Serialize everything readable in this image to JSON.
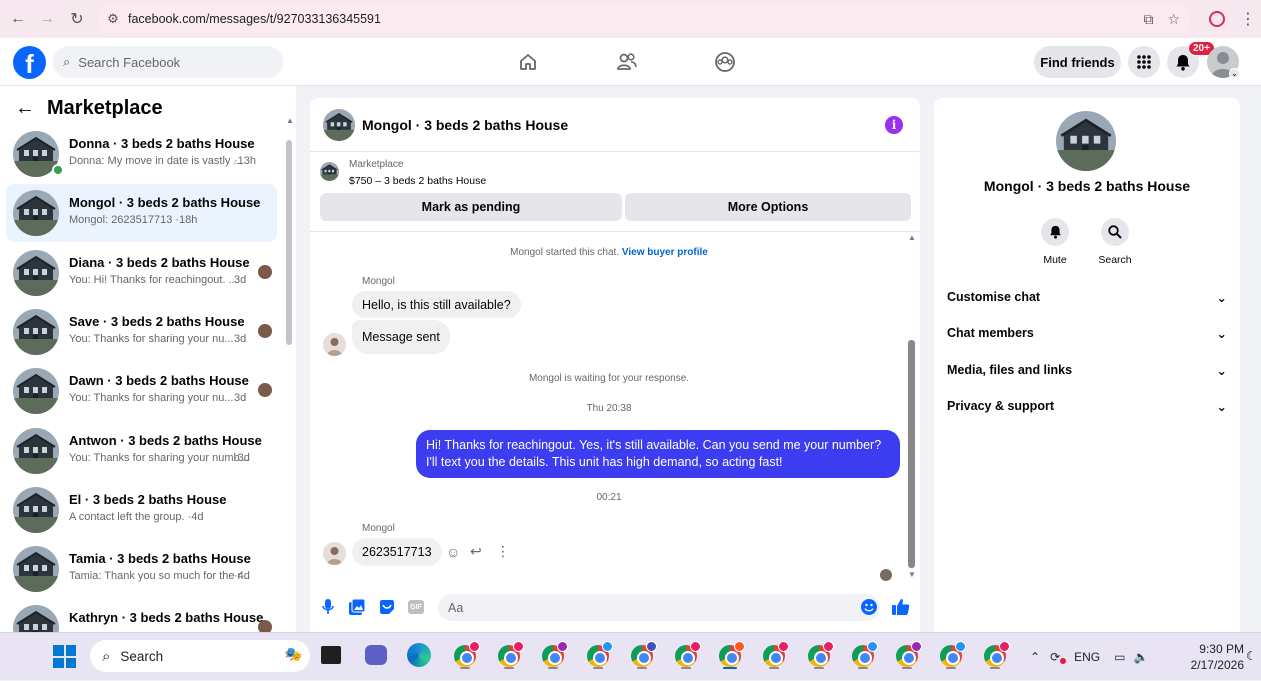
{
  "browser": {
    "url": "facebook.com/messages/t/927033136345591"
  },
  "header": {
    "search_placeholder": "Search Facebook",
    "find_friends": "Find friends",
    "notification_badge": "20+"
  },
  "sidebar": {
    "title": "Marketplace",
    "conversations": [
      {
        "name": "Donna · 3 beds 2 baths House",
        "preview": "Donna: My move in date is vastly ... ",
        "time": "·13h",
        "online": true,
        "active": false
      },
      {
        "name": "Mongol · 3 beds 2 baths House",
        "preview": "Mongol: 2623517713",
        "time": "·18h",
        "online": false,
        "active": true
      },
      {
        "name": "Diana · 3 beds 2 baths House",
        "preview": "You: Hi! Thanks for reachingout. ...",
        "time": "3d",
        "online": false,
        "active": false
      },
      {
        "name": "Save · 3 beds 2 baths House",
        "preview": "You: Thanks for sharing your nu...",
        "time": "3d",
        "online": false,
        "active": false
      },
      {
        "name": "Dawn · 3 beds 2 baths House",
        "preview": "You: Thanks for sharing your nu...",
        "time": "3d",
        "online": false,
        "active": false
      },
      {
        "name": "Antwon · 3 beds 2 baths House",
        "preview": "You: Thanks for sharing your numb...",
        "time": "·3d",
        "online": false,
        "active": false
      },
      {
        "name": "El · 3 beds 2 baths House",
        "preview": "A contact left the group.",
        "time": "·4d",
        "online": false,
        "active": false
      },
      {
        "name": "Tamia · 3 beds 2 baths House",
        "preview": "Tamia: Thank you so much for the r...",
        "time": "·4d",
        "online": false,
        "active": false
      },
      {
        "name": "Kathryn · 3 beds 2 baths House",
        "preview": "",
        "time": "",
        "online": false,
        "active": false
      }
    ]
  },
  "chat": {
    "title": "Mongol · 3 beds 2 baths House",
    "listing_label": "Marketplace",
    "listing_price": "$750 – 3 beds 2 baths House",
    "mark_pending": "Mark as pending",
    "more_options": "More Options",
    "started_text": "Mongol started this chat.",
    "view_profile": "View buyer profile",
    "sender_name": "Mongol",
    "msg1": "Hello, is this still available?",
    "msg2": "Message sent",
    "waiting": "Mongol is waiting for your response.",
    "time1": "Thu 20:38",
    "outgoing": "Hi! Thanks for reachingout. Yes, it's still available. Can you send me your number? I'll text you the details. This unit has high demand, so acting fast!",
    "time2": "00:21",
    "sender_name2": "Mongol",
    "msg3": "2623517713",
    "composer_placeholder": "Aa"
  },
  "details": {
    "title": "Mongol · 3 beds 2 baths House",
    "mute": "Mute",
    "search": "Search",
    "rows": [
      "Customise chat",
      "Chat members",
      "Media, files and links",
      "Privacy & support"
    ]
  },
  "taskbar": {
    "search": "Search",
    "lang": "ENG",
    "time": "9:30 PM",
    "date": "2/17/2026"
  },
  "colors": {
    "brand": "#0866ff",
    "outgoing_bubble": "#3c3cf0",
    "online": "#31a24c",
    "info": "#9b30f0"
  }
}
